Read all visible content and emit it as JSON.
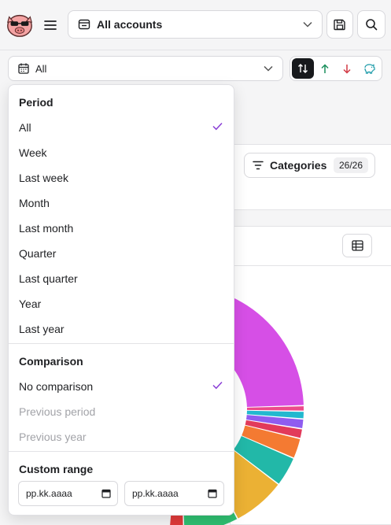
{
  "header": {
    "account_label": "All accounts",
    "icons": [
      "pig-logo",
      "menu-icon",
      "wallet-icon",
      "chevron-down-icon",
      "save-icon",
      "search-icon"
    ]
  },
  "filter": {
    "period_label": "All",
    "directions": [
      "both",
      "income",
      "expense",
      "savings"
    ]
  },
  "categories_button": {
    "label": "Categories",
    "count": "26/26"
  },
  "dropdown": {
    "period_title": "Period",
    "period_options": [
      "All",
      "Week",
      "Last week",
      "Month",
      "Last month",
      "Quarter",
      "Last quarter",
      "Year",
      "Last year"
    ],
    "period_selected": "All",
    "comparison_title": "Comparison",
    "comparison_options": [
      "No comparison",
      "Previous period",
      "Previous year"
    ],
    "comparison_selected": "No comparison",
    "custom_title": "Custom range",
    "date_placeholder_from": "pp.kk.aaaa",
    "date_placeholder_to": "pp.kk.aaaa"
  },
  "colors": {
    "income": "#1a8f5c",
    "expense": "#d23a45",
    "savings": "#1a9aa8",
    "check": "#8a3fd6",
    "donut": [
      "#d64fe6",
      "#ec4a8a",
      "#22b8cf",
      "#8f5cf0",
      "#e23a5a",
      "#f47a32",
      "#22b8a8",
      "#ebb134",
      "#2fbf71",
      "#e03a3a"
    ]
  }
}
